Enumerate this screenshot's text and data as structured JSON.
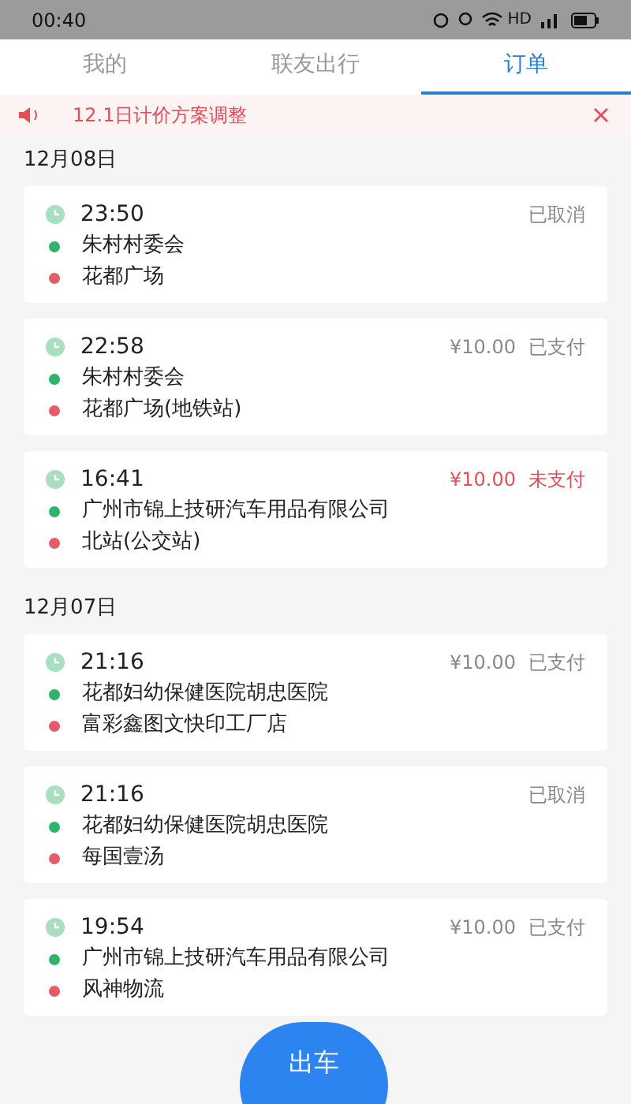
{
  "status_bar": {
    "time": "00:40",
    "network": "HD"
  },
  "tabs": [
    {
      "label": "我的",
      "selected": false
    },
    {
      "label": "联友出行",
      "selected": false
    },
    {
      "label": "订单",
      "selected": true
    }
  ],
  "notice": {
    "text": "12.1日计价方案调整"
  },
  "groups": [
    {
      "date": "12月08日",
      "orders": [
        {
          "time": "23:50",
          "status": "已取消",
          "kind": "cancelled",
          "from": "朱村村委会",
          "to": "花都广场"
        },
        {
          "time": "22:58",
          "price": "¥10.00",
          "status": "已支付",
          "kind": "paid",
          "from": "朱村村委会",
          "to": "花都广场(地铁站)"
        },
        {
          "time": "16:41",
          "price": "¥10.00",
          "status": "未支付",
          "kind": "unpaid",
          "from": "广州市锦上技研汽车用品有限公司",
          "to": "北站(公交站)"
        }
      ]
    },
    {
      "date": "12月07日",
      "orders": [
        {
          "time": "21:16",
          "price": "¥10.00",
          "status": "已支付",
          "kind": "paid",
          "from": "花都妇幼保健医院胡忠医院",
          "to": "富彩鑫图文快印工厂店"
        },
        {
          "time": "21:16",
          "status": "已取消",
          "kind": "cancelled",
          "from": "花都妇幼保健医院胡忠医院",
          "to": "每国壹汤"
        },
        {
          "time": "19:54",
          "price": "¥10.00",
          "status": "已支付",
          "kind": "paid",
          "from": "广州市锦上技研汽车用品有限公司",
          "to": "风神物流"
        }
      ]
    }
  ],
  "action_button": {
    "label": "出车"
  }
}
